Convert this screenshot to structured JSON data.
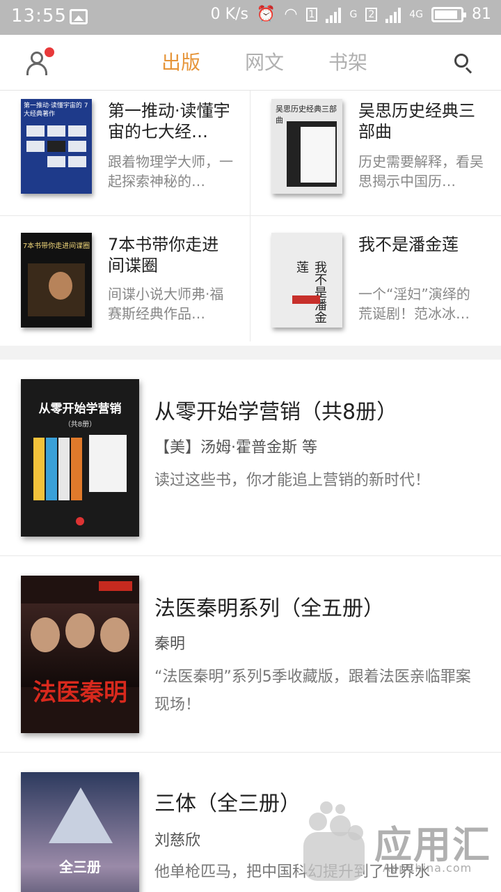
{
  "status_bar": {
    "time": "13:55",
    "net_speed": "0 K/s",
    "sim1": "1",
    "sim1_type": "G",
    "sim2": "2",
    "sim2_type": "4G",
    "battery": "81"
  },
  "nav": {
    "tabs": [
      {
        "label": "出版",
        "active": true
      },
      {
        "label": "网文",
        "active": false
      },
      {
        "label": "书架",
        "active": false
      }
    ],
    "accent": "#e6953a",
    "notification_dot_color": "#e8393a"
  },
  "grid": [
    {
      "title": "第一推动·读懂宇宙的七大经…",
      "desc": "跟着物理学大师，一起探索神秘的…",
      "cover_text": "第一推动·读懂宇宙的 7大经典著作"
    },
    {
      "title": "吴思历史经典三部曲",
      "desc": "历史需要解释，看吴思揭示中国历…",
      "cover_text": "吴思历史经典三部曲"
    },
    {
      "title": "7本书带你走进间谍圈",
      "desc": "间谍小说大师弗·福赛斯经典作品…",
      "cover_text": "7本书带你走进间谍圈"
    },
    {
      "title": "我不是潘金莲",
      "desc": "一个“淫妇”演绎的荒诞剧！范冰冰…",
      "cover_text": "我不是潘金莲"
    }
  ],
  "list": [
    {
      "title": "从零开始学营销（共8册）",
      "author": "【美】汤姆·霍普金斯 等",
      "desc": "读过这些书，你才能追上营销的新时代！",
      "cover_title": "从零开始学营销",
      "cover_sub": "（共8册）"
    },
    {
      "title": "法医秦明系列（全五册）",
      "author": "秦明",
      "desc": "“法医秦明”系列5季收藏版，跟着法医亲临罪案现场！",
      "cover_title": "法医秦明"
    },
    {
      "title": "三体（全三册）",
      "author": "刘慈欣",
      "desc": "他单枪匹马，把中国科幻提升到了世界水",
      "cover_title": "全三册"
    }
  ],
  "watermark": {
    "brand": "应用汇",
    "domain": "AppChina.com"
  }
}
